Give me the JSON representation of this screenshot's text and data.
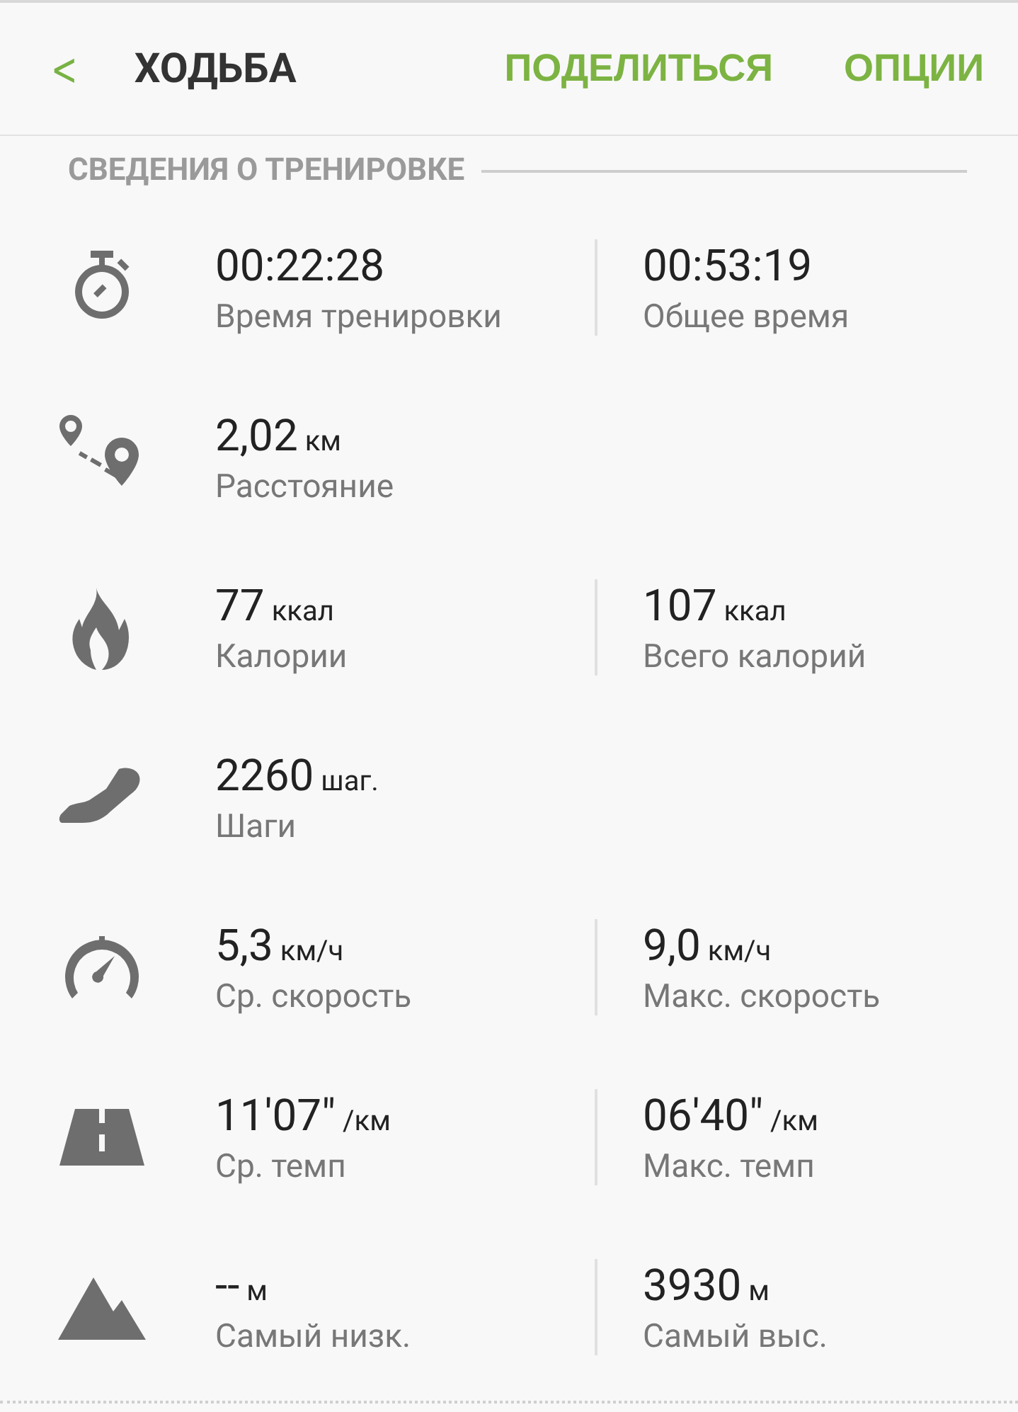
{
  "header": {
    "back_icon": "<",
    "title": "ХОДЬБА",
    "actions": [
      "ПОДЕЛИТЬСЯ",
      "ОПЦИИ"
    ]
  },
  "section": {
    "title": "СВЕДЕНИЯ О ТРЕНИРОВКЕ"
  },
  "rows": [
    {
      "kind": "stopwatch",
      "cells": [
        {
          "value": "00:22:28",
          "label": "Время тренировки"
        },
        {
          "value": "00:53:19",
          "label": "Общее время"
        }
      ]
    },
    {
      "kind": "route",
      "cells": [
        {
          "value": "2,02",
          "unit": "км",
          "label": "Расстояние"
        }
      ]
    },
    {
      "kind": "flame",
      "cells": [
        {
          "value": "77",
          "unit": "ккал",
          "label": "Калории"
        },
        {
          "value": "107",
          "unit": "ккал",
          "label": "Всего калорий"
        }
      ]
    },
    {
      "kind": "shoe",
      "cells": [
        {
          "value": "2260",
          "unit": "шаг.",
          "label": "Шаги"
        }
      ]
    },
    {
      "kind": "speedometer",
      "cells": [
        {
          "value": "5,3",
          "unit": "км/ч",
          "label": "Ср. скорость"
        },
        {
          "value": "9,0",
          "unit": "км/ч",
          "label": "Макс. скорость"
        }
      ]
    },
    {
      "kind": "road",
      "cells": [
        {
          "value": "11'07\"",
          "unit": "/км",
          "label": "Ср. темп"
        },
        {
          "value": "06'40\"",
          "unit": "/км",
          "label": "Макс. темп"
        }
      ]
    },
    {
      "kind": "mountain",
      "cells": [
        {
          "value": "--",
          "unit": "м",
          "label": "Самый низк."
        },
        {
          "value": "3930",
          "unit": "м",
          "label": "Самый выс."
        }
      ]
    }
  ]
}
